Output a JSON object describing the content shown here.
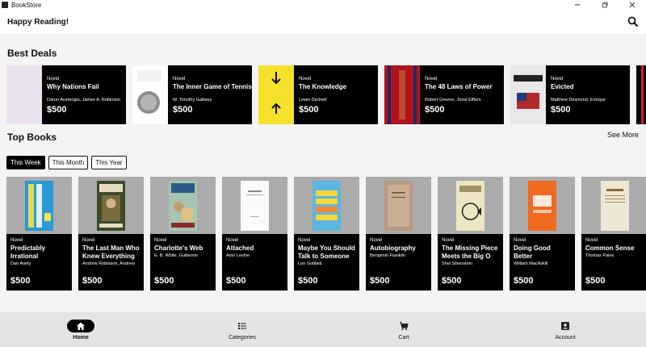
{
  "window": {
    "title": "BookStore"
  },
  "header": {
    "greeting": "Happy Reading!"
  },
  "sections": {
    "best_deals": "Best Deals",
    "top_books": "Top Books",
    "see_more": "See More"
  },
  "best_deals": [
    {
      "genre": "Novel",
      "title": "Why Nations Fail",
      "author": "Daron Acemoglu, James A. Robinson",
      "price": "$500",
      "cover_color": "#e9e2ee"
    },
    {
      "genre": "Novel",
      "title": "The Inner Game of Tennis",
      "author": "W. Timothy Gallwey",
      "price": "$500",
      "cover_color": "#ffffff"
    },
    {
      "genre": "Novel",
      "title": "The Knowledge",
      "author": "Lewis Dartnell",
      "price": "$500",
      "cover_color": "#f5e12a",
      "cover_text": "ABRIR EN CASO DE APOCALIPSIS"
    },
    {
      "genre": "Novel",
      "title": "The 48 Laws of Power",
      "author": "Robert Greene, Joost Elffers",
      "price": "$500",
      "cover_color": "#b0131c",
      "cover_text": "POWER"
    },
    {
      "genre": "Novel",
      "title": "Evicted",
      "author": "Matthew Desmond, Enrique",
      "price": "$500",
      "cover_color": "#e8e8e8",
      "cover_text": "EVICTED"
    }
  ],
  "tabs": [
    {
      "label": "This Week",
      "active": true
    },
    {
      "label": "This Month",
      "active": false
    },
    {
      "label": "This Year",
      "active": false
    }
  ],
  "top_books": [
    {
      "genre": "Novel",
      "title": "Predictably Irrational",
      "author": "Dan Ariely",
      "price": "$500",
      "cover_color": "#2a9ad4",
      "cover_text": "PREDICTABLY IRRATIONAL"
    },
    {
      "genre": "Novel",
      "title": "The Last Man Who Knew Everything",
      "author": "Andrew Robinson, Andrew",
      "price": "$500",
      "cover_color": "#3d4a2a"
    },
    {
      "genre": "Novel",
      "title": "Charlotte's Web",
      "author": "E. B. White, Guillermo",
      "price": "$500",
      "cover_color": "#a6c4b0",
      "cover_text": "Charlotte's Web"
    },
    {
      "genre": "Novel",
      "title": "Attached",
      "author": "Amir Levine",
      "price": "$500",
      "cover_color": "#ffffff"
    },
    {
      "genre": "Novel",
      "title": "Maybe You Should Talk to Someone",
      "author": "Lori Gottlieb",
      "price": "$500",
      "cover_color": "#5bb6e0",
      "cover_text": "MAYBE YOU SHOULD TALK TO SOMEONE"
    },
    {
      "genre": "Novel",
      "title": "Autobiography",
      "author": "Benjamin Franklin",
      "price": "$500",
      "cover_color": "#b89a82"
    },
    {
      "genre": "Novel",
      "title": "The Missing Piece Meets the Big O",
      "author": "Shel Silverstein",
      "price": "$500",
      "cover_color": "#eee6c2",
      "cover_text": "THE MISSING PIECE BIG O"
    },
    {
      "genre": "Novel",
      "title": "Doing Good Better",
      "author": "William MacAskill",
      "price": "$500",
      "cover_color": "#f06b1f",
      "cover_text": "DOING GOOD BETTER"
    },
    {
      "genre": "Novel",
      "title": "Common Sense",
      "author": "Thomas Paine",
      "price": "$500",
      "cover_color": "#efe7d6"
    }
  ],
  "bottom_nav": [
    {
      "label": "Home",
      "icon": "home-icon",
      "active": true
    },
    {
      "label": "Categories",
      "icon": "list-icon",
      "active": false
    },
    {
      "label": "Cart",
      "icon": "cart-icon",
      "active": false
    },
    {
      "label": "Account",
      "icon": "account-icon",
      "active": false
    }
  ]
}
